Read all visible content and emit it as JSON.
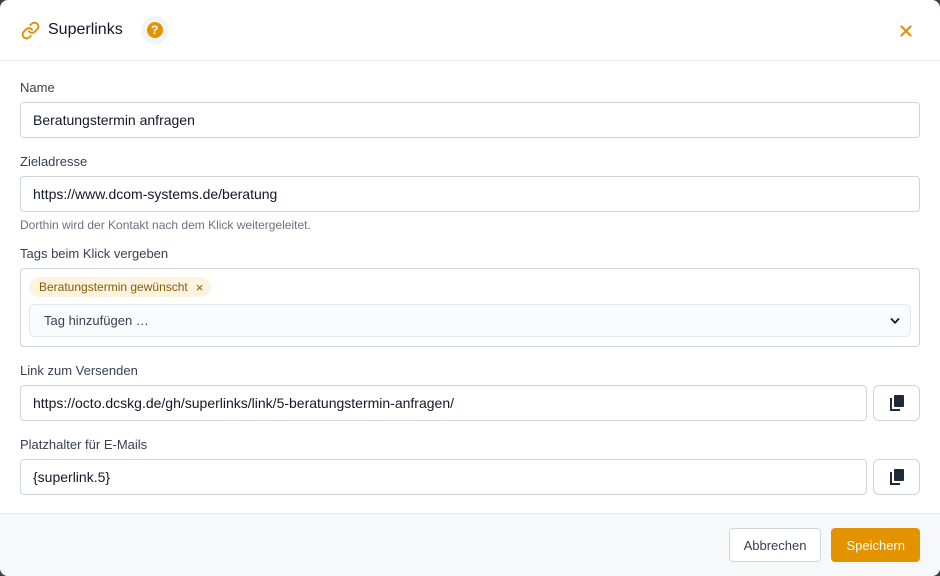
{
  "colors": {
    "accent": "#e39200",
    "tag_bg": "#fdf3e1",
    "tag_text": "#8a5a00",
    "border": "#d1d5db"
  },
  "header": {
    "icon": "link-icon",
    "title": "Superlinks",
    "help_icon": "help-icon",
    "help_glyph": "?",
    "close_icon": "close-icon"
  },
  "fields": {
    "name": {
      "label": "Name",
      "value": "Beratungstermin anfragen"
    },
    "target": {
      "label": "Zieladresse",
      "value": "https://www.dcom-systems.de/beratung",
      "hint": "Dorthin wird der Kontakt nach dem Klick weitergeleitet."
    },
    "tags": {
      "label": "Tags beim Klick vergeben",
      "chips": [
        {
          "label": "Beratungstermin gewünscht",
          "remove": "×"
        }
      ],
      "select_placeholder": "Tag hinzufügen …"
    },
    "link": {
      "label": "Link zum Versenden",
      "value": "https://octo.dcskg.de/gh/superlinks/link/5-beratungstermin-anfragen/",
      "copy_icon": "copy-icon"
    },
    "placeholder": {
      "label": "Platzhalter für E-Mails",
      "value": "{superlink.5}",
      "copy_icon": "copy-icon"
    }
  },
  "footer": {
    "cancel_label": "Abbrechen",
    "save_label": "Speichern"
  }
}
